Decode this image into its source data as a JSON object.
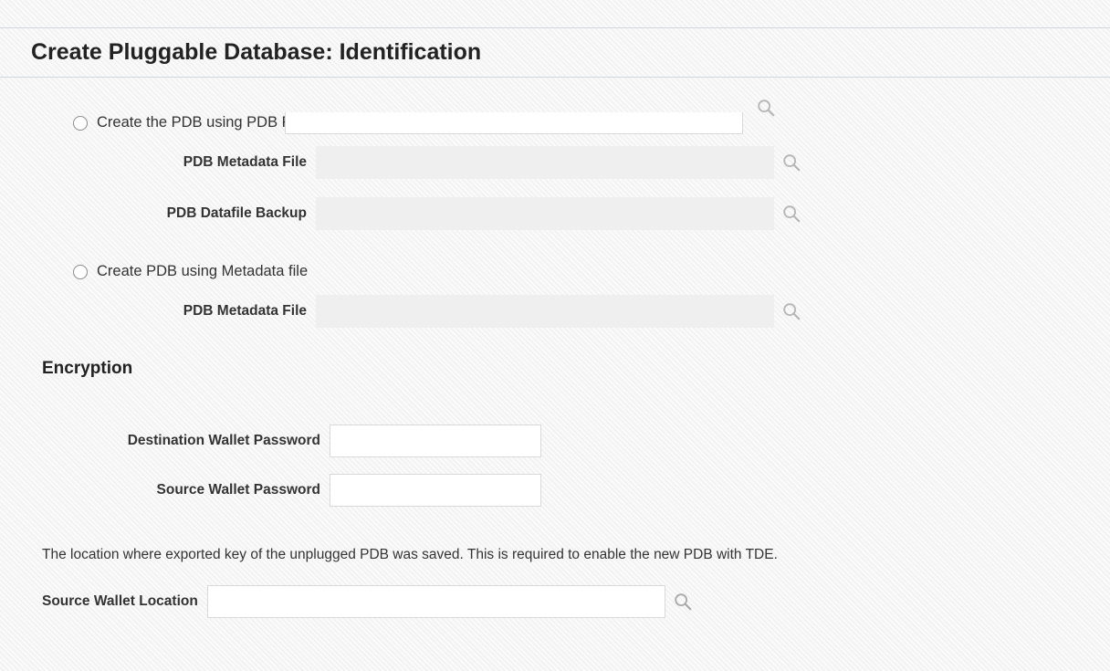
{
  "header": {
    "title": "Create Pluggable Database: Identification"
  },
  "options": {
    "fileSet": {
      "radioLabel": "Create the PDB using PDB File Set",
      "metadataLabel": "PDB Metadata File",
      "metadataValue": "",
      "backupLabel": "PDB Datafile Backup",
      "backupValue": ""
    },
    "metadataOnly": {
      "radioLabel": "Create PDB using Metadata file",
      "metadataLabel": "PDB Metadata File",
      "metadataValue": ""
    }
  },
  "encryption": {
    "heading": "Encryption",
    "destPasswordLabel": "Destination Wallet Password",
    "destPasswordValue": "",
    "srcPasswordLabel": "Source Wallet Password",
    "srcPasswordValue": "",
    "helpText": "The location where exported key of the unplugged PDB was saved. This is required to enable the new PDB with TDE.",
    "srcLocationLabel": "Source Wallet Location",
    "srcLocationValue": ""
  },
  "topInput": {
    "value": ""
  }
}
